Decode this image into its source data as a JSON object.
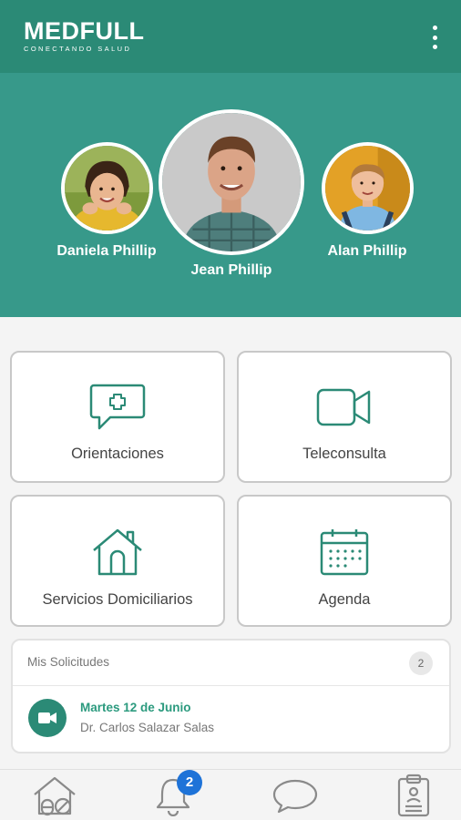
{
  "app": {
    "brand": "MEDFULL",
    "tagline": "CONECTANDO SALUD"
  },
  "profiles": [
    {
      "name": "Daniela Phillip"
    },
    {
      "name": "Jean Phillip",
      "selected": true
    },
    {
      "name": "Alan Phillip"
    }
  ],
  "services": [
    {
      "label": "Orientaciones",
      "icon": "chat-plus-icon"
    },
    {
      "label": "Teleconsulta",
      "icon": "video-camera-icon"
    },
    {
      "label": "Servicios Domiciliarios",
      "icon": "house-icon"
    },
    {
      "label": "Agenda",
      "icon": "calendar-icon"
    }
  ],
  "requests": {
    "title": "Mis Solicitudes",
    "count": "2",
    "items": [
      {
        "date": "Martes 12 de Junio",
        "doctor": "Dr. Carlos Salazar Salas",
        "icon": "video-camera-icon"
      }
    ]
  },
  "bottom_nav": {
    "items": [
      {
        "icon": "home-pill-icon"
      },
      {
        "icon": "bell-icon",
        "badge": "2"
      },
      {
        "icon": "chat-bubble-icon"
      },
      {
        "icon": "clipboard-icon"
      }
    ]
  },
  "colors": {
    "header": "#2b8a76",
    "band": "#37998a",
    "accent": "#2b9a7e",
    "badge": "#1e73d8"
  }
}
